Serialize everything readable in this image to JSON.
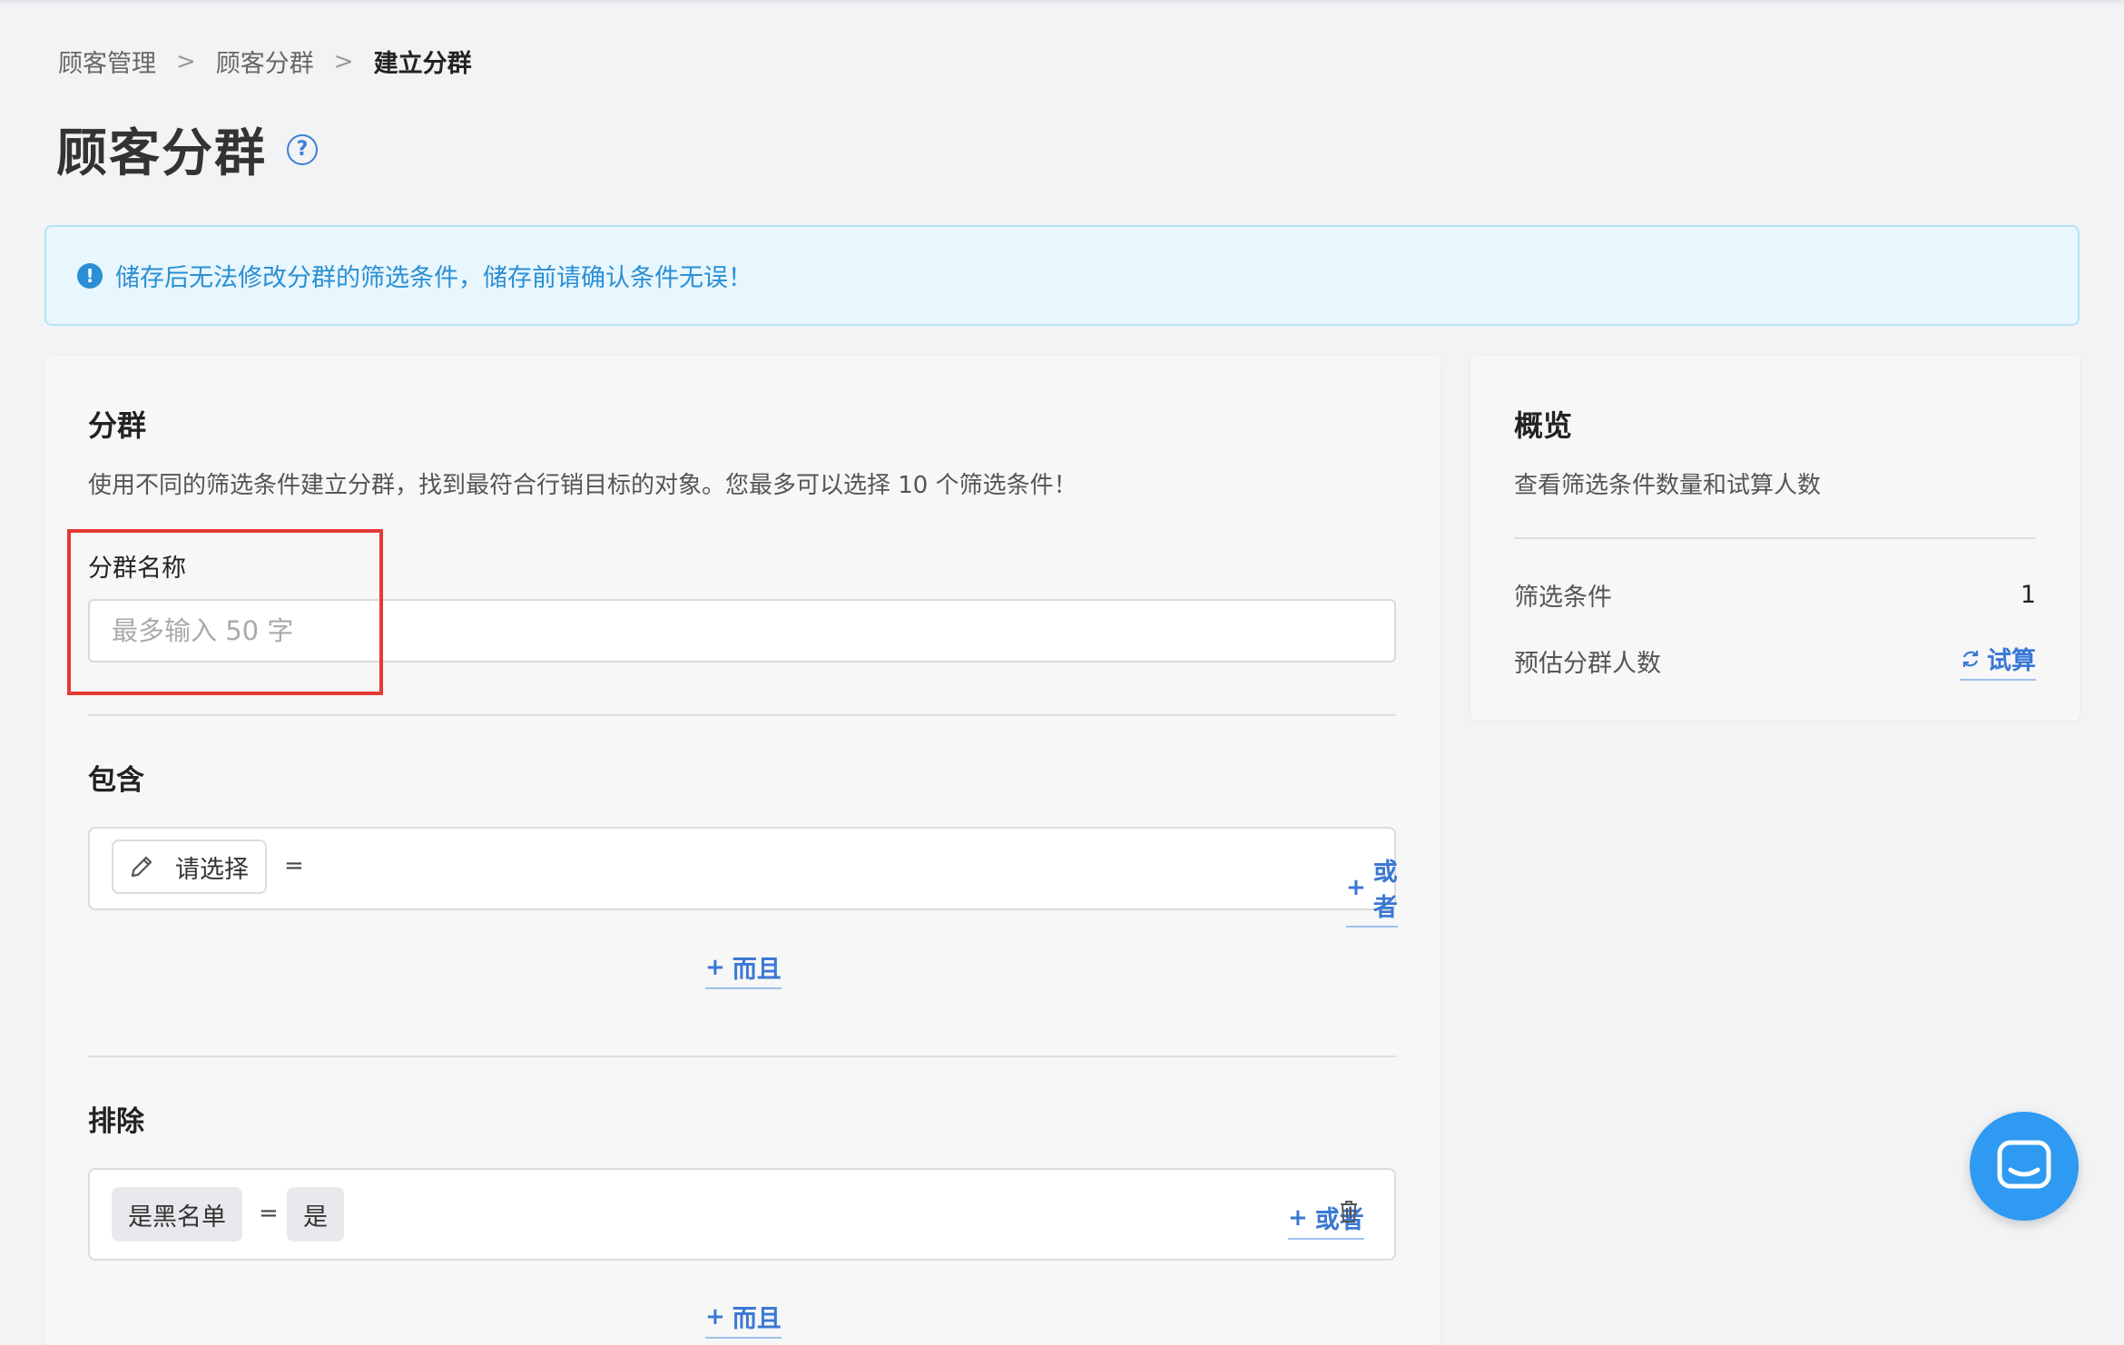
{
  "breadcrumb": {
    "items": [
      "顾客管理",
      "顾客分群",
      "建立分群"
    ],
    "separator": ">"
  },
  "page": {
    "title": "顾客分群",
    "help_icon": "question-circle-icon"
  },
  "alert": {
    "icon": "exclamation-circle-icon",
    "text": "储存后无法修改分群的筛选条件，储存前请确认条件无误！",
    "color": "#2a8fd4"
  },
  "segment": {
    "title": "分群",
    "description": "使用不同的筛选条件建立分群，找到最符合行销目标的对象。您最多可以选择 10 个筛选条件！",
    "name_label": "分群名称",
    "name_value": "",
    "name_placeholder": "最多输入 50 字"
  },
  "include": {
    "title": "包含",
    "select_label": "请选择",
    "select_icon": "pencil-icon",
    "operator": "=",
    "or_label": "或者",
    "and_label": "而且"
  },
  "exclude": {
    "title": "排除",
    "field_tag": "是黑名单",
    "operator": "=",
    "value_tag": "是",
    "or_label": "或者",
    "delete_icon": "trash-icon",
    "and_label": "而且"
  },
  "overview": {
    "title": "概览",
    "description": "查看筛选条件数量和试算人数",
    "filter_count_label": "筛选条件",
    "filter_count_value": "1",
    "estimate_label": "预估分群人数",
    "estimate_action": "试算",
    "estimate_icon": "refresh-icon"
  },
  "chat": {
    "icon": "chat-bubble-icon"
  },
  "colors": {
    "accent": "#3a78d4",
    "highlight": "#e53935",
    "chat": "#2e9af2"
  }
}
